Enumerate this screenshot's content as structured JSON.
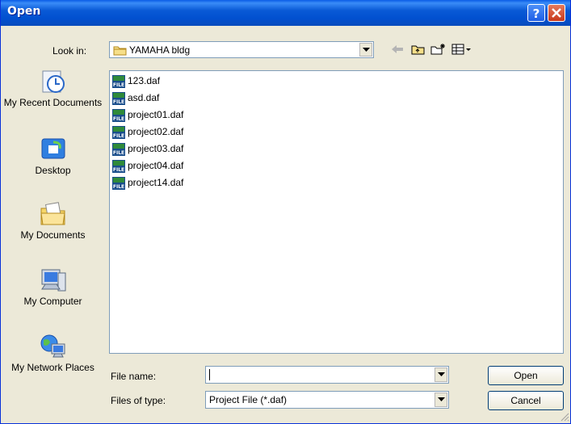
{
  "window": {
    "title": "Open"
  },
  "lookin": {
    "label": "Look in:",
    "value": "YAMAHA bldg"
  },
  "places": [
    {
      "label": "My Recent Documents",
      "icon": "recent-documents-icon"
    },
    {
      "label": "Desktop",
      "icon": "desktop-icon"
    },
    {
      "label": "My Documents",
      "icon": "my-documents-icon"
    },
    {
      "label": "My Computer",
      "icon": "my-computer-icon"
    },
    {
      "label": "My Network Places",
      "icon": "network-places-icon"
    }
  ],
  "files": [
    "123.daf",
    "asd.daf",
    "project01.daf",
    "project02.daf",
    "project03.daf",
    "project04.daf",
    "project14.daf"
  ],
  "filename": {
    "label": "File name:",
    "value": ""
  },
  "filetype": {
    "label": "Files of type:",
    "value": "Project File (*.daf)"
  },
  "buttons": {
    "open": "Open",
    "cancel": "Cancel"
  },
  "colors": {
    "titlebar": "#0a5ce6",
    "dialog": "#ece9d8",
    "border": "#7f9db9"
  }
}
